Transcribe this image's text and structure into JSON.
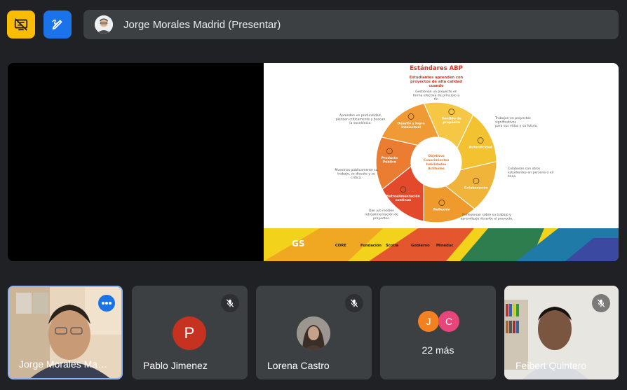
{
  "presenter": {
    "label": "Jorge Morales Madrid (Presentar)"
  },
  "slide": {
    "title": "Estándares ABP",
    "top_statement": [
      "Estudiantes aprenden con",
      "proyectos de alta calidad",
      "cuando"
    ],
    "center": [
      "Objetivos",
      "Conocimientos",
      "habilidades",
      "Actitudes"
    ],
    "segments": [
      {
        "label": [
          "Sentido de",
          "propósito"
        ],
        "annotation": [
          "Gestionan un proyecto en",
          "forma efectiva de principio a",
          "fin"
        ]
      },
      {
        "label": [
          "Autenticidad"
        ],
        "annotation": [
          "Trabajan en proyectos",
          "significativos",
          "para sus vidas y su futuro."
        ]
      },
      {
        "label": [
          "Colaboración"
        ],
        "annotation": [
          "Colaboran con otros",
          "estudiantes en persona o en",
          "línea."
        ]
      },
      {
        "label": [
          "Reflexión"
        ],
        "annotation": [
          "Reflexionan sobre su trabajo y",
          "aprendizaje durante el proyecto."
        ]
      },
      {
        "label": [
          "Retroalimentación",
          "continua"
        ],
        "annotation": [
          "Dan y/o reciben",
          "retroalimentación de",
          "proyectos."
        ]
      },
      {
        "label": [
          "Producto",
          "Público"
        ],
        "annotation": [
          "Muestran públicamente su",
          "trabajo, se discute y se",
          "critica."
        ]
      },
      {
        "label": [
          "Desafío y logro",
          "intelectual"
        ],
        "annotation": [
          "Aprenden en profundidad,",
          "piensan críticamente y buscan",
          "la excelencia."
        ]
      }
    ],
    "footer_logos": [
      "GS",
      "CORE",
      "Fundación",
      "Scotia",
      "Gobierno",
      "Mineduc"
    ]
  },
  "participants": [
    {
      "name": "Jorge Morales Ma…",
      "type": "video"
    },
    {
      "name": "Pablo Jimenez",
      "initial": "P",
      "muted": true
    },
    {
      "name": "Lorena Castro",
      "muted": true
    },
    {
      "initials": [
        "J",
        "C"
      ],
      "more": "22 más"
    },
    {
      "name": "Feibert Quintero",
      "muted": true,
      "type": "video"
    }
  ],
  "colors": {
    "bg": "#202124",
    "tile": "#3c4043",
    "accent_yellow": "#fbbc04",
    "accent_blue": "#1a73e8",
    "pablo": "#c5321f",
    "j_avatar": "#f4811f",
    "c_avatar": "#e8457a",
    "seg_1": "#f6c744",
    "seg_2": "#f2c230",
    "seg_3": "#f0b43a",
    "seg_4": "#ee9a2c",
    "seg_5": "#e24a2b",
    "seg_6": "#ea7d31",
    "seg_7": "#f09a35"
  }
}
